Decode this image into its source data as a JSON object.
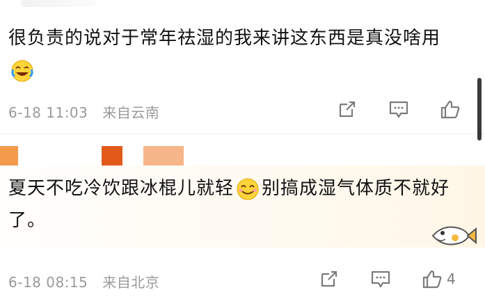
{
  "comments": [
    {
      "text_before_emoji": "很负责的说对于常年祛湿的我来讲这东西是真没啥用",
      "emoji": "laughing-crying-emoji",
      "date": "6-18 11:03",
      "source": "来自云南",
      "like_count": ""
    },
    {
      "text_before_emoji": "夏天不吃冷饮跟冰棍儿就轻",
      "emoji": "smiling-emoji",
      "text_after_emoji": "别搞成湿气体质不就好了。",
      "date": "6-18 08:15",
      "source": "来自北京",
      "like_count": "4"
    }
  ],
  "icons": {
    "share": "share-icon",
    "comment": "comment-icon",
    "like": "thumbs-up-icon",
    "sticker": "fish-sticker"
  },
  "colors": {
    "text": "#111111",
    "meta": "#9a9a9a",
    "icon": "#7a7a7a",
    "swatch_orange": "#f39a4d",
    "swatch_red": "#e15a1a",
    "swatch_peach": "#f7b58a"
  }
}
